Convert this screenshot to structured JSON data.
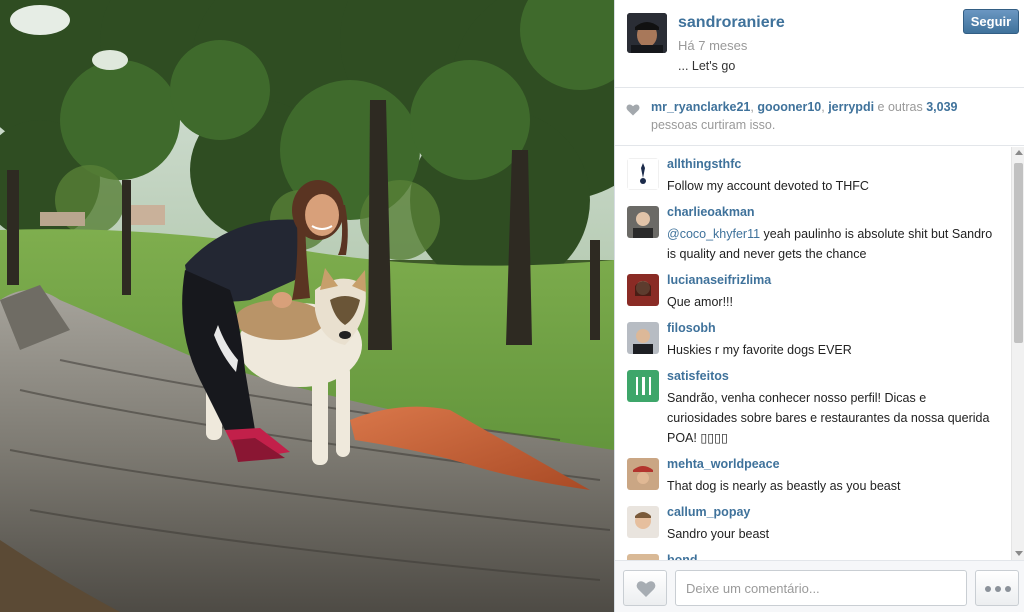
{
  "post": {
    "username": "sandroraniere",
    "time": "Há 7 meses",
    "caption": "... Let's go",
    "follow_label": "Seguir"
  },
  "likes": {
    "users": [
      "mr_ryanclarke21",
      "goooner10",
      "jerrypdi"
    ],
    "separator": ", ",
    "others_text": " e outras ",
    "count": "3,039",
    "suffix": "pessoas curtiram isso."
  },
  "comments": [
    {
      "user": "allthingsthfc",
      "text": "Follow my account devoted to THFC"
    },
    {
      "user": "charlieoakman",
      "mention": "@coco_khyfer11",
      "text": " yeah paulinho is absolute shit but Sandro is quality and never gets the chance"
    },
    {
      "user": "lucianaseifrizlima",
      "text": "Que amor!!!"
    },
    {
      "user": "filosobh",
      "text": "Huskies r my favorite dogs EVER"
    },
    {
      "user": "satisfeitos",
      "text": "Sandrão, venha conhecer nosso perfil! Dicas e curiosidades sobre bares e restaurantes da nossa querida POA! ▯▯▯▯"
    },
    {
      "user": "mehta_worldpeace",
      "text": "That dog is nearly as beastly as you beast"
    },
    {
      "user": "callum_popay",
      "text": "Sandro your beast"
    },
    {
      "user": "bond",
      "text": ""
    }
  ],
  "footer": {
    "comment_placeholder": "Deixe um comentário..."
  },
  "icons": {
    "like": "heart-icon",
    "more": "more-dots-icon"
  },
  "colors": {
    "link": "#3f729b",
    "muted": "#999999",
    "follow_button": "#3f729b"
  }
}
